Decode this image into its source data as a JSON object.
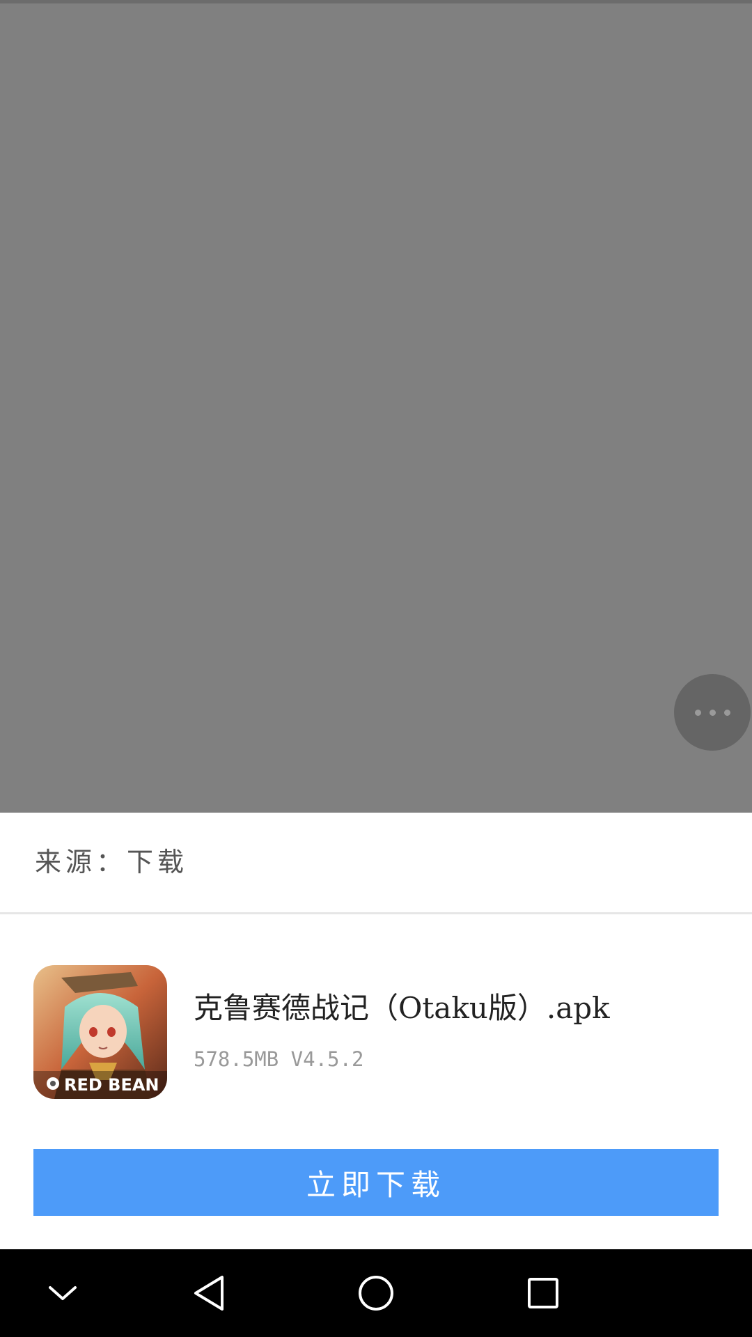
{
  "sheet": {
    "source_label": "来源：下载",
    "app": {
      "name": "克鲁赛德战记（Otaku版）.apk",
      "meta": "578.5MB V4.5.2",
      "icon_badge_text": "RED BEAN"
    },
    "download_label": "立即下载"
  },
  "overlay": {
    "more_button_icon": "more-dots-icon"
  },
  "nav_bar": {
    "icons": [
      "chevron-down-icon",
      "back-triangle-icon",
      "home-circle-icon",
      "recents-square-icon"
    ]
  },
  "colors": {
    "overlay": "#808080",
    "primary_button": "#4d9bf9",
    "nav_bar": "#000000"
  }
}
